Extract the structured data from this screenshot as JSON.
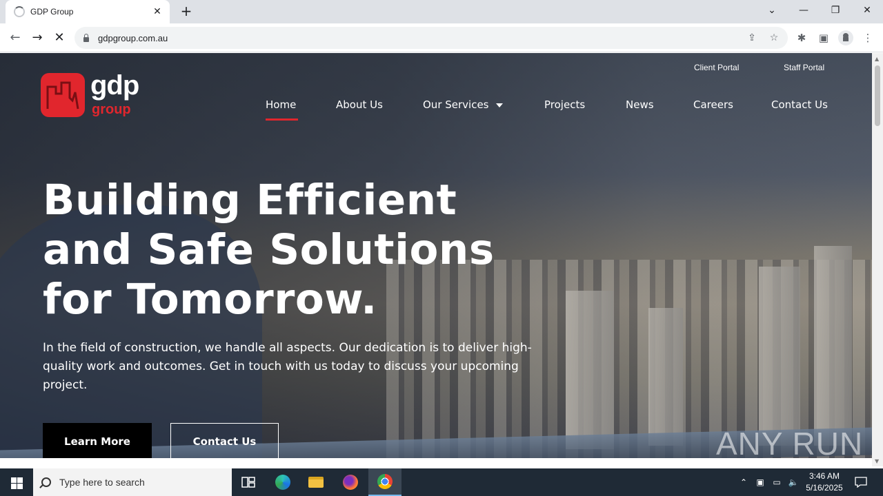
{
  "browser": {
    "tab_title": "GDP Group",
    "url": "gdpgroup.com.au"
  },
  "site": {
    "logo": {
      "primary": "gdp",
      "secondary": "group"
    },
    "portals": [
      "Client Portal",
      "Staff Portal"
    ],
    "nav": [
      {
        "label": "Home",
        "active": true
      },
      {
        "label": "About Us"
      },
      {
        "label": "Our Services",
        "dropdown": true
      },
      {
        "label": "Projects"
      },
      {
        "label": "News"
      },
      {
        "label": "Careers"
      },
      {
        "label": "Contact Us"
      }
    ],
    "hero": {
      "headline": [
        "Building Efficient",
        "and Safe Solutions",
        "for Tomorrow."
      ],
      "subtext": "In the field of construction, we handle all aspects. Our dedication is to deliver high-quality work and outcomes. Get in touch with us today to discuss your upcoming project.",
      "primary_button": "Learn More",
      "secondary_button": "Contact Us"
    },
    "watermark": "ANY RUN",
    "colors": {
      "brand_red": "#e1262d"
    }
  },
  "taskbar": {
    "search_placeholder": "Type here to search",
    "time": "3:46 AM",
    "date": "5/16/2025",
    "apps": [
      "task-view",
      "edge",
      "file-explorer",
      "firefox",
      "chrome"
    ]
  }
}
